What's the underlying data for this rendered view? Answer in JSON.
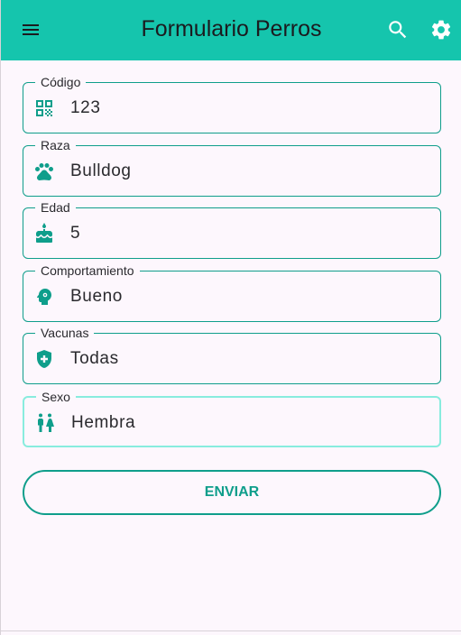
{
  "appbar": {
    "title": "Formulario Perros",
    "menu_icon": "menu-icon",
    "search_icon": "search-icon",
    "settings_icon": "gear-icon",
    "background": "#15c5ad"
  },
  "form": {
    "fields": [
      {
        "label": "Código",
        "value": "123",
        "icon": "qr-code-icon"
      },
      {
        "label": "Raza",
        "value": "Bulldog",
        "icon": "paw-icon"
      },
      {
        "label": "Edad",
        "value": "5",
        "icon": "cake-icon"
      },
      {
        "label": "Comportamiento",
        "value": "Bueno",
        "icon": "psychology-icon"
      },
      {
        "label": "Vacunas",
        "value": "Todas",
        "icon": "health-shield-icon"
      },
      {
        "label": "Sexo",
        "value": "Hembra",
        "icon": "wc-icon"
      }
    ],
    "submit_label": "ENVIAR",
    "accent": "#0f9e8b",
    "focused_border": "#88ecde"
  }
}
